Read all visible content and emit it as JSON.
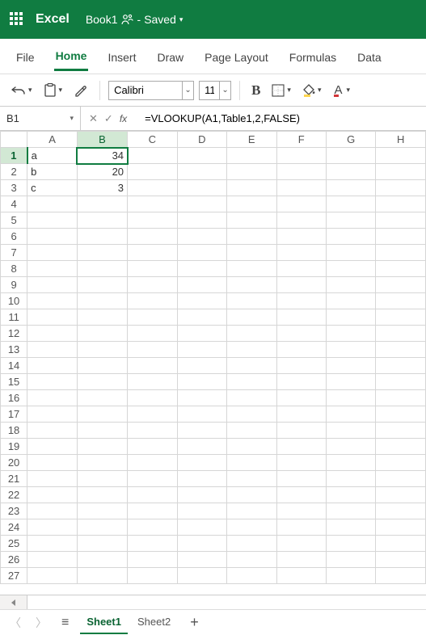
{
  "title": {
    "app": "Excel",
    "doc": "Book1",
    "status": "Saved"
  },
  "menu": {
    "items": [
      "File",
      "Home",
      "Insert",
      "Draw",
      "Page Layout",
      "Formulas",
      "Data"
    ],
    "active": 1
  },
  "ribbon": {
    "font": "Calibri",
    "size": "11"
  },
  "namebox": "B1",
  "formula": "=VLOOKUP(A1,Table1,2,FALSE)",
  "columns": [
    "A",
    "B",
    "C",
    "D",
    "E",
    "F",
    "G",
    "H"
  ],
  "rows": 27,
  "selected": {
    "row": 1,
    "col": "B"
  },
  "cells": {
    "A1": "a",
    "B1": "34",
    "A2": "b",
    "B2": "20",
    "A3": "c",
    "B3": "3"
  },
  "tabs": {
    "items": [
      "Sheet1",
      "Sheet2"
    ],
    "active": 0
  },
  "colors": {
    "fill_accent": "#ffd54f",
    "font_accent": "#d13438"
  }
}
